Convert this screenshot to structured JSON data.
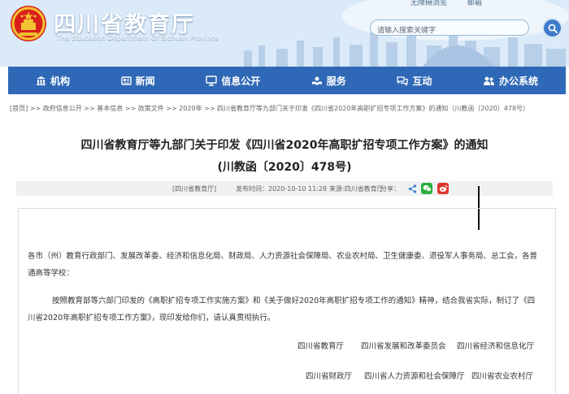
{
  "header": {
    "site_title": "四川省教育厅",
    "site_subtitle": "The Education Department Of Sichuan Province",
    "top_links": [
      "无障碍浏览",
      "邮箱"
    ],
    "search_placeholder": "请输入搜索关键字",
    "colors": {
      "nav": "#2f68b6",
      "header_bg": "#d7e8f7"
    }
  },
  "nav": {
    "items": [
      {
        "label": "机构",
        "icon": "building-icon"
      },
      {
        "label": "新闻",
        "icon": "newspaper-icon"
      },
      {
        "label": "信息公开",
        "icon": "monitor-icon"
      },
      {
        "label": "服务",
        "icon": "service-icon"
      },
      {
        "label": "互动",
        "icon": "chat-icon"
      },
      {
        "label": "办公系统",
        "icon": "users-icon"
      }
    ]
  },
  "breadcrumb": "[首页] >> 政府信息公开 >> 基本信息 >> 政策文件 >> 2020年 >> 四川省教育厅等九部门关于印发《四川省2020年高职扩招专项工作方案》的通知（川教函〔2020〕478号）",
  "article": {
    "title_line1": "四川省教育厅等九部门关于印发《四川省2020年高职扩招专项工作方案》的通知",
    "title_line2": "(川教函〔2020〕478号)",
    "meta": {
      "source": "[四川省教育厅]",
      "date": "发布时间：2020-10-10 11:28",
      "from": "来源:四川省教育厅",
      "share": "分享："
    },
    "addressee": "各市（州）教育行政部门、发展改革委、经济和信息化局、财政局、人力资源社会保障局、农业农村局、卫生健康委、退役军人事务局、总工会，各普通高等学校：",
    "body": "按照教育部等六部门印发的《高职扩招专项工作实施方案》和《关于做好2020年高职扩招专项工作的通知》精神，结合我省实际，制订了《四川省2020年高职扩招专项工作方案》，现印发给你们，请认真贯彻执行。",
    "signatories_row1": [
      "四川省教育厅",
      "四川省发展和改革委员会",
      "四川省经济和信息化厅"
    ],
    "signatories_row2": [
      "四川省财政厅",
      "四川省人力资源和社会保障厅",
      "四川省农业农村厅"
    ]
  }
}
